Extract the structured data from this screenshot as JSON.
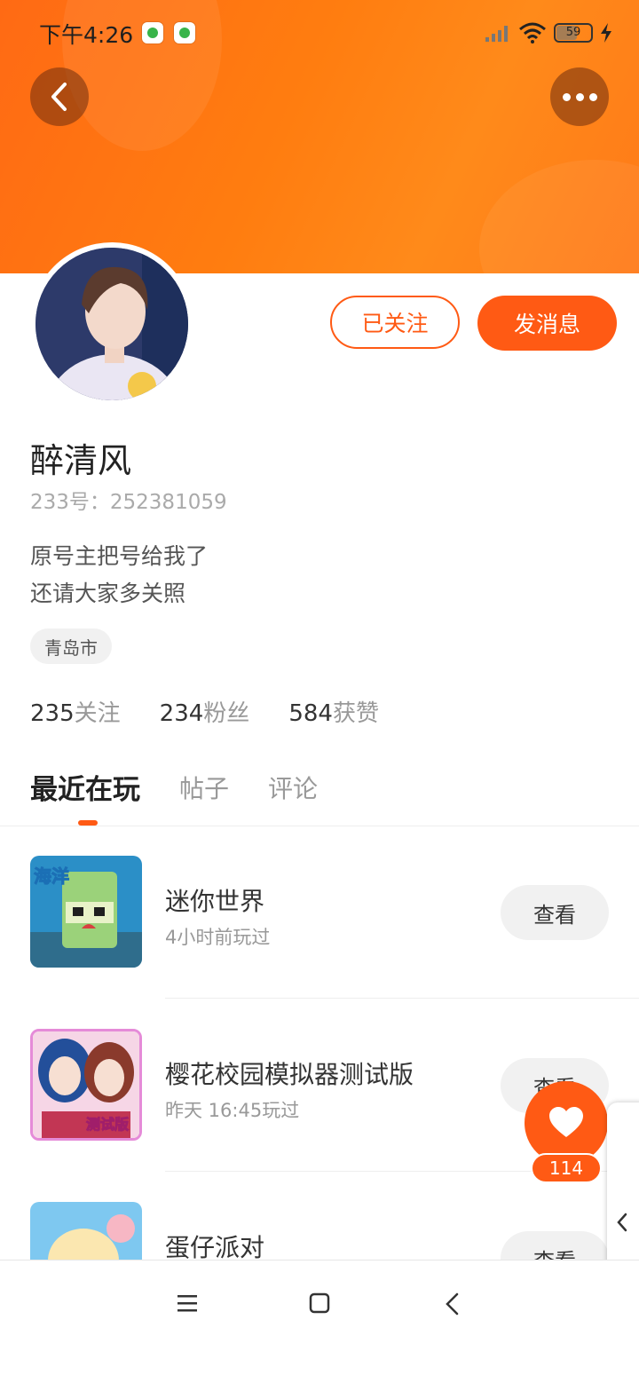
{
  "status_bar": {
    "time": "下午4:26",
    "battery": "59"
  },
  "header": {
    "back_icon": "chevron-left-icon",
    "more_icon": "more-dots-icon"
  },
  "profile": {
    "follow_button": "已关注",
    "message_button": "发消息",
    "name": "醉清风",
    "uid": "233号：252381059",
    "bio_line1": "原号主把号给我了",
    "bio_line2": "还请大家多关照",
    "location": "青岛市",
    "stats": {
      "following_count": "235",
      "following_label": "关注",
      "fans_count": "234",
      "fans_label": "粉丝",
      "likes_count": "584",
      "likes_label": "获赞"
    }
  },
  "tabs": [
    "最近在玩",
    "帖子",
    "评论"
  ],
  "games": [
    {
      "title": "迷你世界",
      "subtitle": "4小时前玩过",
      "button": "查看",
      "icon_text": "海洋"
    },
    {
      "title": "樱花校园模拟器测试版",
      "subtitle": "昨天 16:45玩过",
      "button": "查看",
      "icon_text": "测试版"
    },
    {
      "title": "蛋仔派对",
      "subtitle": "",
      "button": "查看"
    }
  ],
  "like_fab": {
    "count": "114",
    "icon": "heart-icon"
  },
  "colors": {
    "accent": "#ff5a14",
    "header": "#ff7d10"
  }
}
